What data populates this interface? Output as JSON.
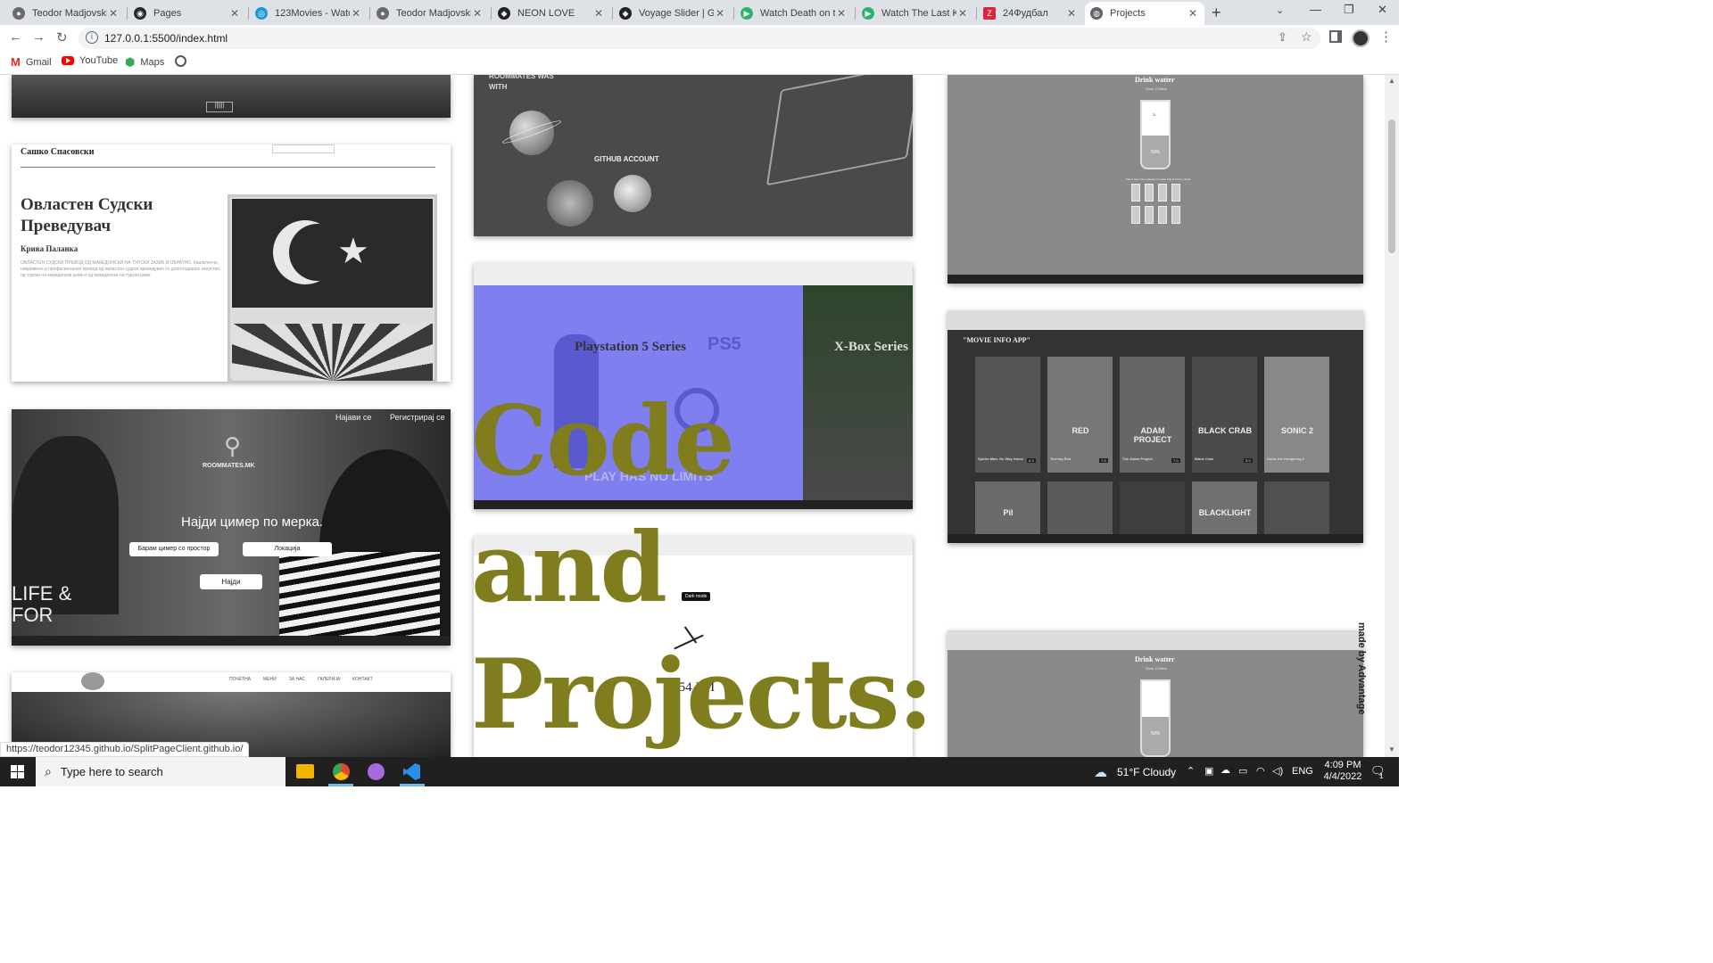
{
  "browser": {
    "tabs": [
      {
        "title": "Teodor Madjovski",
        "icon": "teodor-favicon"
      },
      {
        "title": "Pages",
        "icon": "github-icon"
      },
      {
        "title": "123Movies - Watch",
        "icon": "123movies-icon"
      },
      {
        "title": "Teodor Madjovski",
        "icon": "teodor-favicon"
      },
      {
        "title": "NEON LOVE",
        "icon": "codepen-icon"
      },
      {
        "title": "Voyage Slider | GS",
        "icon": "codepen-icon"
      },
      {
        "title": "Watch Death on th",
        "icon": "play-icon"
      },
      {
        "title": "Watch The Last Kir",
        "icon": "play-icon"
      },
      {
        "title": "24Фудбал",
        "icon": "z-icon"
      },
      {
        "title": "Projects",
        "icon": "globe-icon",
        "active": true
      }
    ],
    "url": "127.0.0.1:5500/index.html",
    "bookmarks": [
      {
        "label": "Gmail",
        "icon": "gmail-icon"
      },
      {
        "label": "YouTube",
        "icon": "youtube-icon"
      },
      {
        "label": "Maps",
        "icon": "maps-icon"
      },
      {
        "label": "",
        "icon": "globe-icon"
      }
    ],
    "status_url": "https://teodor12345.github.io/SplitPageClient.github.io/"
  },
  "page": {
    "title_line1": "Code and",
    "title_line2": "Projects:",
    "side_label": "made by Advantage",
    "cards": {
      "translator": {
        "name": "Сашко Спасовски",
        "heading": "Овластен Судски Преведувач",
        "city": "Крива Паланка",
        "body": "ОВЛАСТЕН СУДСКИ ПРЕВОД ОД МАКЕДОНСКИ НА ТУРСКИ ЈАЗИК И ОБРАТНО. Квалитетно, навремено и професионално превод од овластен судски преведувач со долгогодишно искуство, од турски на македонски јазик и од македонски на турски јазик."
      },
      "roommates": {
        "login": "Најави се",
        "register": "Регистрирај се",
        "logo": "ROOMMATES.MK",
        "headline": "Најди цимер по мерка.",
        "btn_space": "Барам цимер со простор",
        "btn_location": "Локација",
        "btn_find": "Најди",
        "corner": "LIFE & FOR"
      },
      "hotel_nav": [
        "ПОЧЕТНА",
        "МЕНИ",
        "ЗА НАС",
        "ГАЛЕРИЈА",
        "КОНТАКТ"
      ],
      "github_space": {
        "left": "ROOMMATES WAS WITH",
        "link": "GITHUB ACCOUNT"
      },
      "playstation": {
        "ps_title": "Playstation 5 Series",
        "xbox_title": "X-Box Series",
        "tagline": "PLAY HAS NO LIMITS",
        "ps_logo": "PS5"
      },
      "clock": {
        "button": "Dark mode",
        "time": "2:54 PM"
      },
      "water": {
        "title": "Drink watter",
        "goal": "Goal: 2 Liters",
        "remained": "2L",
        "percent": "50%",
        "hint": "Select how many glasses of water that you have drank"
      },
      "movies": {
        "title": "\"MOVIE INFO APP\"",
        "posters": [
          {
            "title": "Spider-Man: No Way Home",
            "rating": "8.3"
          },
          {
            "title": "Turning Red",
            "rating": "7.5",
            "art": "RED"
          },
          {
            "title": "The Adam Project",
            "rating": "7.0",
            "art": "ADAM PROJECT"
          },
          {
            "title": "Black Crab",
            "rating": "5.9",
            "art": "BLACK CRAB"
          },
          {
            "title": "Sonic the Hedgehog 2",
            "rating": "",
            "art": "SONIC 2"
          },
          {
            "title": "",
            "art": "Pil"
          },
          {
            "title": ""
          },
          {
            "title": ""
          },
          {
            "title": "",
            "art": "BLACKLIGHT"
          },
          {
            "title": ""
          }
        ]
      }
    }
  },
  "taskbar": {
    "search_placeholder": "Type here to search",
    "weather": "51°F  Cloudy",
    "lang": "ENG",
    "time": "4:09 PM",
    "date": "4/4/2022",
    "notifications": "1"
  },
  "colors": {
    "title_gold": "#7f7d1e",
    "ps_purple": "#7f7ff0",
    "xbox_green": "#2e452b"
  }
}
